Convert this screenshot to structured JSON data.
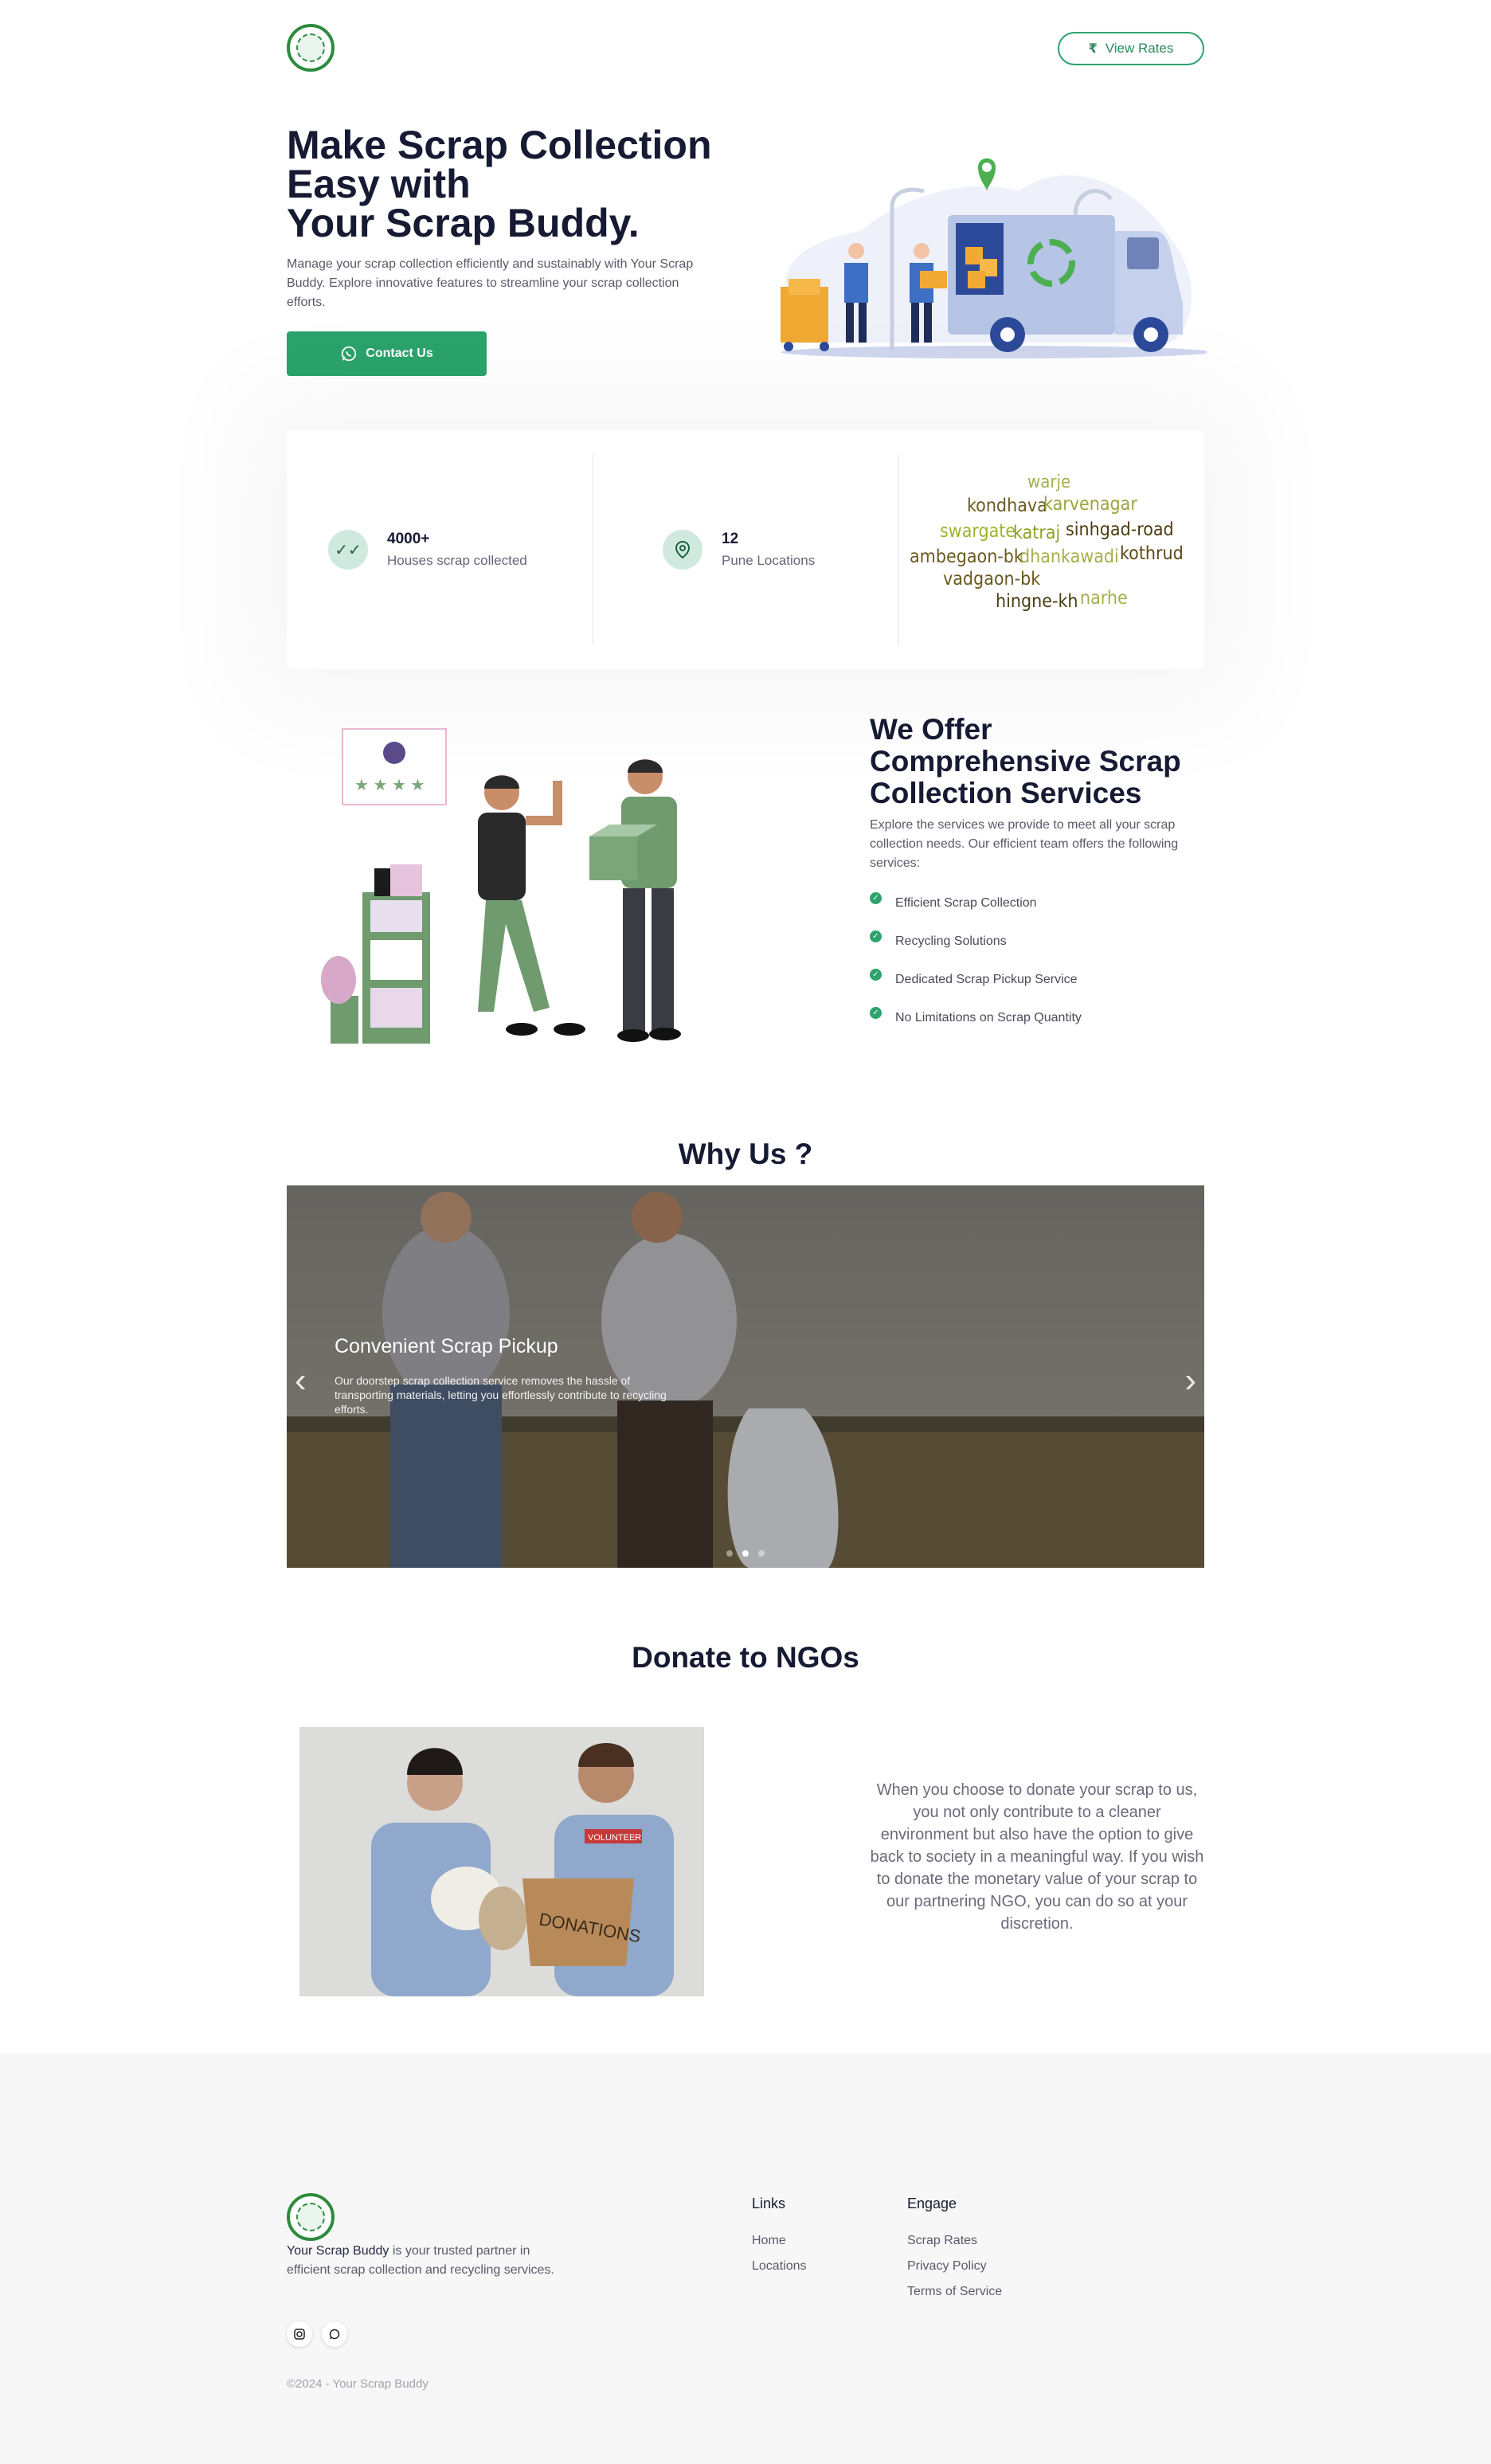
{
  "header": {
    "view_rates_label": "View Rates"
  },
  "hero": {
    "title_line1": "Make Scrap Collection",
    "title_line2": "Easy with",
    "title_brand": "Your Scrap Buddy",
    "title_period": ".",
    "description": "Manage your scrap collection efficiently and sustainably with Your Scrap Buddy. Explore innovative features to streamline your scrap collection efforts.",
    "cta_label": "Contact Us"
  },
  "stats": {
    "houses_value": "4000+",
    "houses_label": "Houses scrap collected",
    "locations_value": "12",
    "locations_label": "Pune Locations",
    "wordcloud": [
      "warje",
      "kondhava",
      "karvenagar",
      "swargate",
      "katraj",
      "sinhgad-road",
      "ambegaon-bk",
      "dhankawadi",
      "kothrud",
      "vadgaon-bk",
      "hingne-kh",
      "narhe"
    ]
  },
  "services": {
    "title": "We Offer Comprehensive Scrap Collection Services",
    "description": "Explore the services we provide to meet all your scrap collection needs. Our efficient team offers the following services:",
    "items": [
      "Efficient Scrap Collection",
      "Recycling Solutions",
      "Dedicated Scrap Pickup Service",
      "No Limitations on Scrap Quantity"
    ]
  },
  "why_us": {
    "title": "Why Us ?",
    "slide_title": "Convenient Scrap Pickup",
    "slide_text": "Our doorstep scrap collection service removes the hassle of transporting materials, letting you effortlessly contribute to recycling efforts."
  },
  "donate": {
    "title": "Donate to NGOs",
    "box_label": "DONATIONS",
    "shirt_label": "VOLUNTEER",
    "text": "When you choose to donate your scrap to us, you not only contribute to a cleaner environment but also have the option to give back to society in a meaningful way. If you wish to donate the monetary value of your scrap to our partnering NGO, you can do so at your discretion."
  },
  "footer": {
    "brand": "Your Scrap Buddy",
    "desc_rest": " is your trusted partner in efficient scrap collection and recycling services.",
    "links_heading": "Links",
    "links": [
      "Home",
      "Locations"
    ],
    "engage_heading": "Engage",
    "engage": [
      "Scrap Rates",
      "Privacy Policy",
      "Terms of Service"
    ],
    "copyright": "©2024 - Your Scrap Buddy"
  },
  "colors": {
    "accent": "#2ba36b",
    "text_dark": "#161a33",
    "footer_bg": "#f7f7f7"
  }
}
